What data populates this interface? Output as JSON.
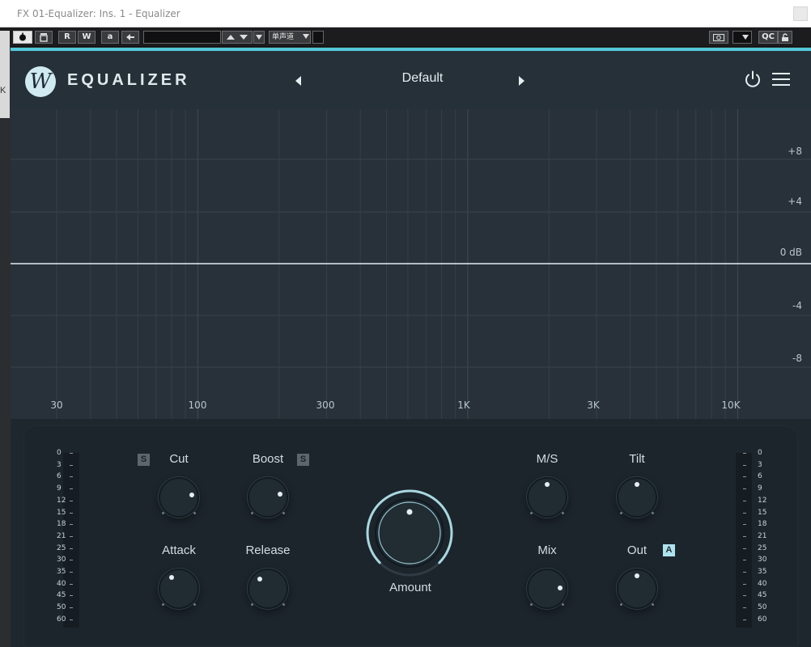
{
  "window": {
    "title": "FX 01-Equalizer: Ins. 1 - Equalizer"
  },
  "host_toolbar": {
    "buttons": [
      "R",
      "W",
      "a",
      "QC"
    ],
    "channel_select": "单声道",
    "left_edge_glyph": "K"
  },
  "plugin": {
    "brand": "EQUALIZER",
    "logo_letter": "W",
    "preset": "Default",
    "accent_color": "#52c7d8"
  },
  "graph": {
    "db_labels": [
      "+8",
      "+4",
      "0 dB",
      "-4",
      "-8"
    ],
    "freq_labels": [
      "30",
      "100",
      "300",
      "1K",
      "3K",
      "10K"
    ]
  },
  "controls": {
    "cut": {
      "label": "Cut",
      "badge": "S",
      "value": 0.8
    },
    "boost": {
      "label": "Boost",
      "badge": "S",
      "value": 0.78
    },
    "attack": {
      "label": "Attack",
      "value": 0.38
    },
    "release": {
      "label": "Release",
      "value": 0.35
    },
    "amount": {
      "label": "Amount",
      "value": 0.5
    },
    "ms": {
      "label": "M/S",
      "value": 0.5
    },
    "tilt": {
      "label": "Tilt",
      "value": 0.5
    },
    "mix": {
      "label": "Mix",
      "value": 0.82
    },
    "out": {
      "label": "Out",
      "badge": "A",
      "value": 0.5
    }
  },
  "meters": {
    "left_scale": [
      "0",
      "3",
      "6",
      "9",
      "12",
      "15",
      "18",
      "21",
      "25",
      "30",
      "35",
      "40",
      "45",
      "50",
      "60"
    ],
    "right_scale": [
      "0",
      "3",
      "6",
      "9",
      "12",
      "15",
      "18",
      "21",
      "25",
      "30",
      "35",
      "40",
      "45",
      "50",
      "60"
    ]
  }
}
